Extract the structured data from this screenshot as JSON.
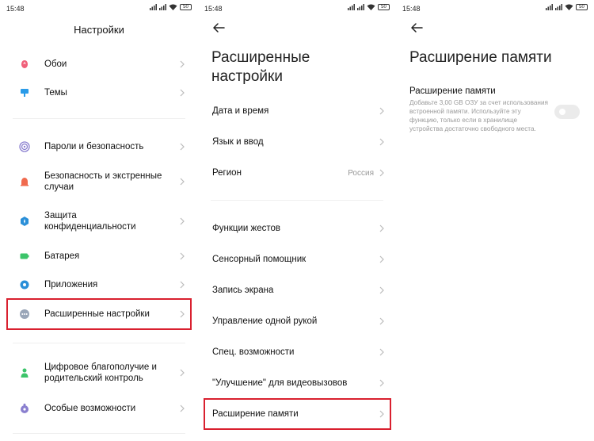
{
  "status_time": "15:48",
  "battery_level": "50",
  "panel1": {
    "title": "Настройки",
    "items": [
      {
        "label": "Обои",
        "icon": "wallpaper-icon",
        "color": "#f0607a"
      },
      {
        "label": "Темы",
        "icon": "themes-icon",
        "color": "#2a9be8"
      },
      {
        "label": "Пароли и безопасность",
        "icon": "passwords-icon",
        "color": "#8a7fcf"
      },
      {
        "label": "Безопасность и экстренные случаи",
        "icon": "emergency-icon",
        "color": "#f06a4e"
      },
      {
        "label": "Защита конфиденциальности",
        "icon": "privacy-icon",
        "color": "#2a8fd8"
      },
      {
        "label": "Батарея",
        "icon": "battery-icon",
        "color": "#3cc46a"
      },
      {
        "label": "Приложения",
        "icon": "apps-icon",
        "color": "#2a8fd8"
      },
      {
        "label": "Расширенные настройки",
        "icon": "more-icon",
        "color": "#9aa6b8"
      },
      {
        "label": "Цифровое благополучие и родительский контроль",
        "icon": "wellbeing-icon",
        "color": "#3cc46a"
      },
      {
        "label": "Особые возможности",
        "icon": "accessibility-icon",
        "color": "#8a7fcf"
      }
    ]
  },
  "panel2": {
    "title_line1": "Расширенные",
    "title_line2": "настройки",
    "items": [
      {
        "label": "Дата и время"
      },
      {
        "label": "Язык и ввод"
      },
      {
        "label": "Регион",
        "value": "Россия"
      },
      {
        "label": "Функции жестов"
      },
      {
        "label": "Сенсорный помощник"
      },
      {
        "label": "Запись экрана"
      },
      {
        "label": "Управление одной рукой"
      },
      {
        "label": "Спец. возможности"
      },
      {
        "label": "\"Улучшение\" для видеовызовов"
      },
      {
        "label": "Расширение памяти"
      }
    ]
  },
  "panel3": {
    "title": "Расширение памяти",
    "setting_title": "Расширение памяти",
    "setting_description": "Добавьте 3,00 GB ОЗУ за счет использования встроенной памяти. Используйте эту функцию, только если в хранилище устройства достаточно свободного места.",
    "toggle_on": false
  },
  "highlight_color": "#d9202f"
}
